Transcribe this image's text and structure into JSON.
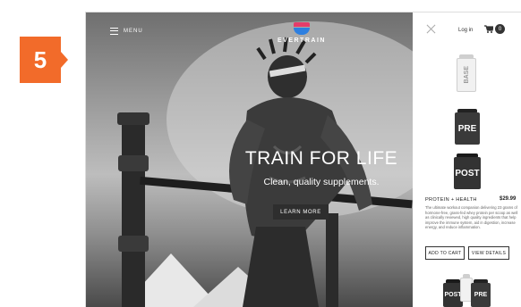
{
  "step": {
    "number": "5"
  },
  "hero": {
    "menu_label": "MENU",
    "brand": "EVERTRAIN",
    "headline": "TRAIN FOR LIFE",
    "subline": "Clean, quality supplements.",
    "cta_label": "LEARN MORE"
  },
  "panel": {
    "login_label": "Log in",
    "cart_count": "0",
    "tubs": [
      {
        "label": "BASE"
      },
      {
        "label": "PRE"
      },
      {
        "label": "POST"
      }
    ],
    "product": {
      "title": "PROTEIN + HEALTH",
      "price": "$29.99",
      "description": "The ultimate workout companion delivering 23 grams of hormone-free, grass-fed whey protein per scoop as well as clinically reviewed, high quality ingredients that help improve the immune system, aid in digestion, increase energy, and reduce inflammation.",
      "add_to_cart": "ADD TO CART",
      "view_details": "VIEW DETAILS"
    },
    "bundle_labels": [
      "POST",
      "PRE"
    ]
  },
  "colors": {
    "badge": "#f26b2a",
    "logo_top": "#e53c6a",
    "logo_bottom": "#2d7fe0"
  }
}
